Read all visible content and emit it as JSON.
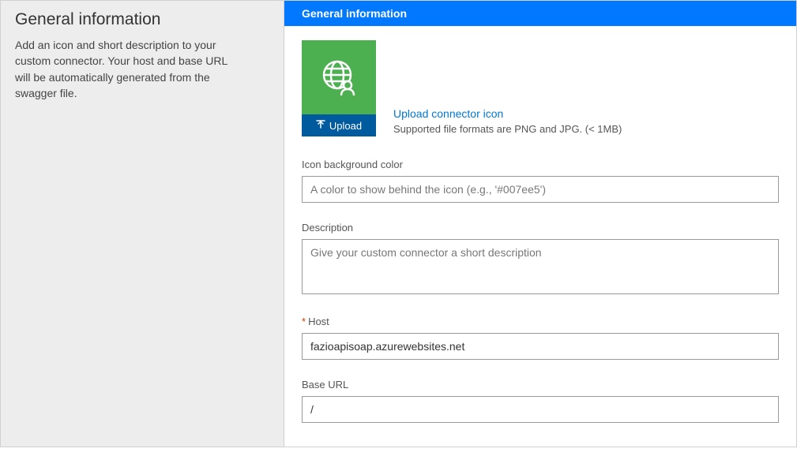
{
  "sidebar": {
    "title": "General information",
    "description": "Add an icon and short description to your custom connector. Your host and base URL will be automatically generated from the swagger file."
  },
  "header": {
    "title": "General information"
  },
  "iconSection": {
    "uploadButtonLabel": "Upload",
    "uploadLink": "Upload connector icon",
    "supportedText": "Supported file formats are PNG and JPG. (< 1MB)",
    "iconBgColor": "#4caf50"
  },
  "fields": {
    "iconBgColor": {
      "label": "Icon background color",
      "placeholder": "A color to show behind the icon (e.g., '#007ee5')",
      "value": ""
    },
    "description": {
      "label": "Description",
      "placeholder": "Give your custom connector a short description",
      "value": ""
    },
    "host": {
      "label": "Host",
      "required": true,
      "value": "fazioapisoap.azurewebsites.net"
    },
    "baseUrl": {
      "label": "Base URL",
      "value": "/"
    }
  }
}
